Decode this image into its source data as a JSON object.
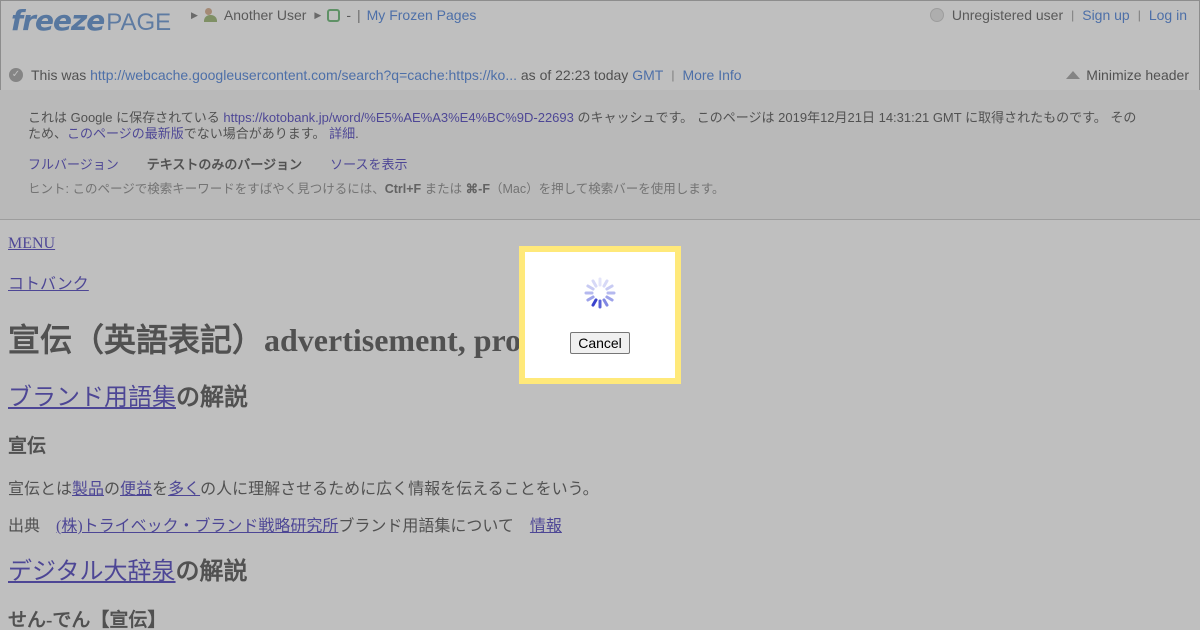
{
  "header": {
    "logo_freeze": "freeze",
    "logo_page": "PAGE",
    "breadcrumb_user": "Another User",
    "breadcrumb_dash": "-",
    "breadcrumb_sep": "|",
    "breadcrumb_link": "My Frozen Pages",
    "unregistered": "Unregistered user",
    "signup": "Sign up",
    "login": "Log in",
    "bar": "|",
    "info_prefix": "This was",
    "info_url": "http://webcache.googleusercontent.com/search?q=cache:https://ko...",
    "info_asof": "as of 22:23 today",
    "info_gmt": "GMT",
    "more_info": "More Info",
    "minimize": "Minimize header"
  },
  "cache": {
    "line_a": "これは Google に保存されている",
    "url": "https://kotobank.jp/word/%E5%AE%A3%E4%BC%9D-22693",
    "line_b": "のキャッシュです。 このページは 2019年12月21日 14:31:21 GMT に取得されたものです。 その",
    "line_c": "ため、",
    "latest_link": "このページの最新版",
    "line_d": "でない場合があります。",
    "detail_link": "詳細",
    "period": ".",
    "view_full": "フルバージョン",
    "view_text": "テキストのみのバージョン",
    "view_source": "ソースを表示",
    "hint_a": "ヒント: このページで検索キーワードをすばやく見つけるには、",
    "hint_key1": "Ctrl+F",
    "hint_b": "または",
    "hint_key2": "⌘-F",
    "hint_c": "（Mac）を押して検索バーを使用します。"
  },
  "content": {
    "menu": "MENU",
    "kotobank": "コトバンク",
    "title": "宣伝（英語表記）advertisement, pro",
    "section1_link": "ブランド用語集",
    "section_suffix": "の解説",
    "term1": "宣伝",
    "def_a": "宣伝とは",
    "def_link1": "製品",
    "def_b": "の",
    "def_link2": "便益",
    "def_c": "を",
    "def_link3": "多く",
    "def_d": "の人に理解させるために広く情報を伝えることをいう。",
    "source_label": "出典",
    "source_link": "(株)トライベック・ブランド戦略研究所",
    "source_text": "ブランド用語集について",
    "info_link": "情報",
    "section2_link": "デジタル大辞泉",
    "term2": "せん-でん【宣伝】"
  },
  "modal": {
    "cancel": "Cancel"
  }
}
